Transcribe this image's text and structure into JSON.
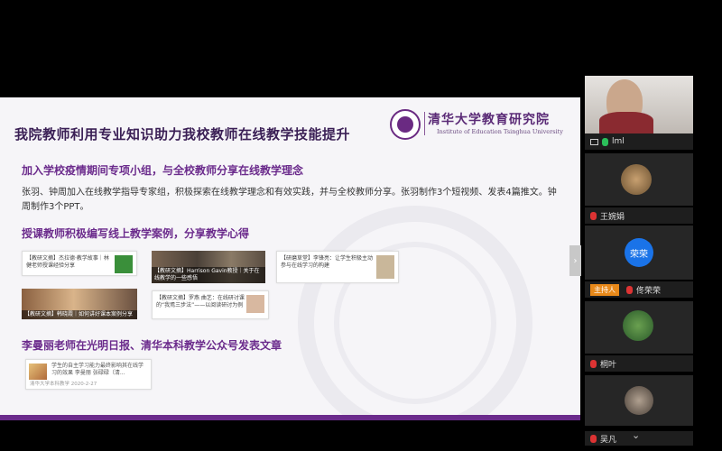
{
  "slide": {
    "title": "我院教师利用专业知识助力我校教师在线教学技能提升",
    "logo_cn": "清华大学教育研究院",
    "logo_en": "Institute of Education Tsinghua University",
    "section1": {
      "heading": "加入学校疫情期间专项小组，与全校教师分享在线教学理念",
      "body": "张羽、钟周加入在线教学指导专家组，积极探索在线教学理念和有效实践，并与全校教师分享。张羽制作3个短视频、发表4篇推文。钟周制作3个PPT。"
    },
    "section2": {
      "heading": "授课教师积极编写线上教学案例，分享教学心得",
      "cards": [
        {
          "text": "【教研文摘】杰拉德·教学故事｜林健老师授课经验分享"
        },
        {
          "text": "【教研文摘】Harrison Gavin教授｜关于在线教学的一些感悟"
        },
        {
          "text": "【研磨草堂】李锋亮：让学生积极主动参与在线学习的构建"
        },
        {
          "text": "【教研文摘】韩晓霞｜如何讲好课本案例分享"
        },
        {
          "text": "【教研文摘】罗燕 曲艺：在线研讨课的“我焉三步法”——以阅读研讨为例"
        }
      ]
    },
    "section3": {
      "heading": "李曼丽老师在光明日报、清华本科教学公众号发表文章",
      "article_text": "学生的自主学习能力最终影响其在线学习的效果 李曼丽 张碌碌（清...",
      "article_source": "清华大学本科教学 2020-2-27"
    }
  },
  "participants": [
    {
      "name": "lml",
      "mic": "on"
    },
    {
      "name": "王婉娟",
      "mic": "muted"
    },
    {
      "name": "佟荣荣",
      "mic": "muted",
      "role": "主持人",
      "initials": "荣荣"
    },
    {
      "name": "桐叶",
      "mic": "muted"
    },
    {
      "name": "吴凡",
      "mic": "muted"
    }
  ],
  "colors": {
    "accent": "#6b2b8c",
    "host": "#e8891a",
    "avatar_blue": "#1a73e8"
  }
}
